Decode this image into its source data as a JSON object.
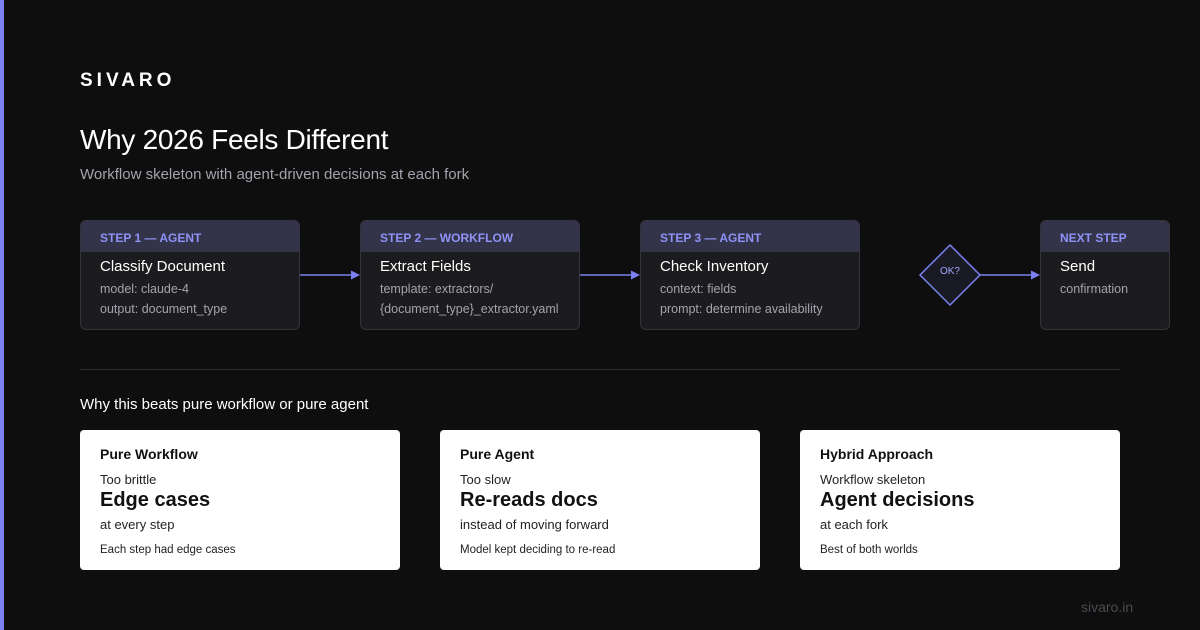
{
  "brand": "SIVARO",
  "title": "Why 2026 Feels Different",
  "subtitle": "Workflow skeleton with agent-driven decisions at each fork",
  "steps": [
    {
      "label": "STEP 1 — AGENT",
      "name": "Classify Document",
      "lines": [
        "model: claude-4",
        "output: document_type"
      ]
    },
    {
      "label": "STEP 2 — WORKFLOW",
      "name": "Extract Fields",
      "lines": [
        "template: extractors/",
        "{document_type}_extractor.yaml"
      ]
    },
    {
      "label": "STEP 3 — AGENT",
      "name": "Check Inventory",
      "lines": [
        "context: fields",
        "prompt: determine availability"
      ]
    },
    {
      "label": "NEXT STEP",
      "name": "Send",
      "lines": [
        "confirmation"
      ]
    }
  ],
  "decision": {
    "label": "OK?"
  },
  "section_title": "Why this beats pure workflow or pure agent",
  "cards": [
    {
      "title": "Pure Workflow",
      "tag": "Too brittle",
      "big": "Edge cases",
      "desc": "at every step",
      "note": "Each step had edge cases"
    },
    {
      "title": "Pure Agent",
      "tag": "Too slow",
      "big": "Re-reads docs",
      "desc": "instead of moving forward",
      "note": "Model kept deciding to re-read"
    },
    {
      "title": "Hybrid Approach",
      "tag": "Workflow skeleton",
      "big": "Agent decisions",
      "desc": "at each fork",
      "note": "Best of both worlds"
    }
  ],
  "footer_url": "sivaro.in",
  "colors": {
    "background": "#0e0e0f",
    "accent": "#7b82f0",
    "step_header_bg": "#33334a",
    "step_label": "#8f93f5",
    "card_bg": "#ffffff"
  }
}
